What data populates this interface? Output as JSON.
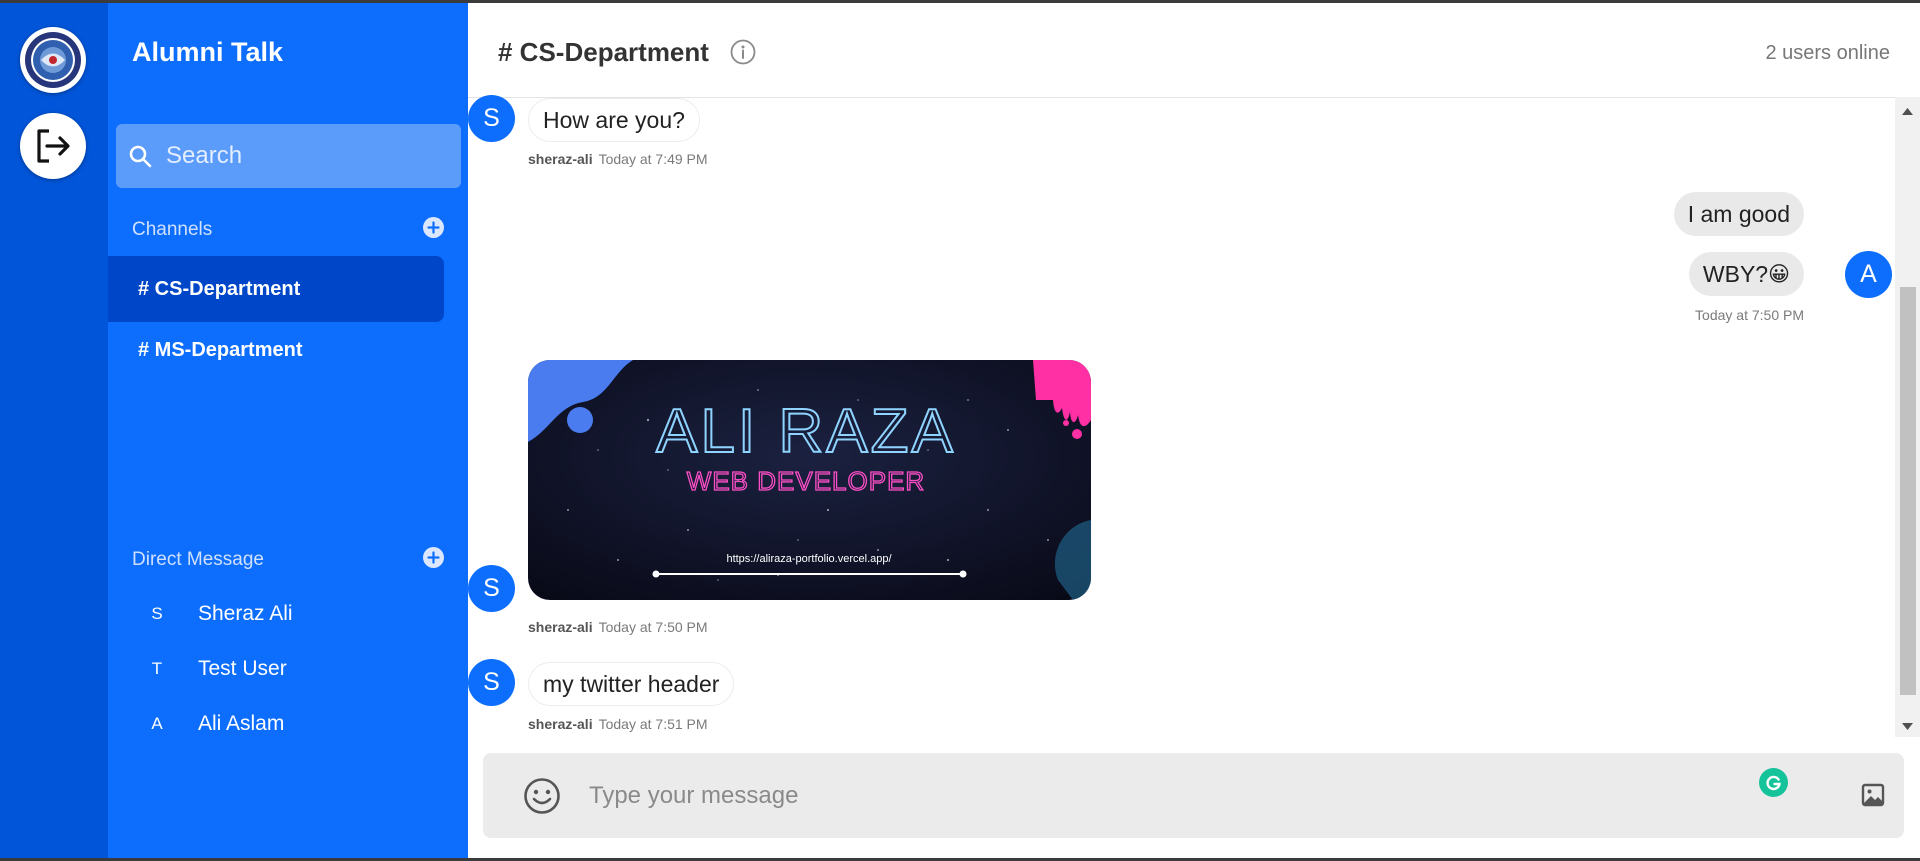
{
  "app": {
    "title": "Alumni Talk"
  },
  "rail": {
    "logo_icon": "university-seal-icon",
    "logout_icon": "logout-icon"
  },
  "search": {
    "placeholder": "Search",
    "icon": "search-icon"
  },
  "channels": {
    "label": "Channels",
    "items": [
      {
        "label": "# CS-Department",
        "active": true
      },
      {
        "label": "# MS-Department",
        "active": false
      }
    ]
  },
  "direct_messages": {
    "label": "Direct Message",
    "items": [
      {
        "initial": "S",
        "name": "Sheraz Ali"
      },
      {
        "initial": "T",
        "name": "Test User"
      },
      {
        "initial": "A",
        "name": "Ali Aslam"
      }
    ]
  },
  "chat": {
    "channel_title": "# CS-Department",
    "online_status": "2 users online",
    "messages": [
      {
        "avatar": "S",
        "text": "How are you?",
        "author": "sheraz-ali",
        "time": "Today at 7:49 PM",
        "side": "left"
      },
      {
        "text": "I am good",
        "side": "right"
      },
      {
        "avatar": "A",
        "text": "WBY?",
        "emoji": "😀",
        "time": "Today at 7:50 PM",
        "side": "right"
      },
      {
        "avatar": "S",
        "type": "image",
        "author": "sheraz-ali",
        "time": "Today at 7:50 PM",
        "side": "left",
        "image": {
          "headline": "ALI RAZA",
          "subline": "WEB DEVELOPER",
          "url": "https://aliraza-portfolio.vercel.app/"
        }
      },
      {
        "avatar": "S",
        "text": "my twitter header",
        "author": "sheraz-ali",
        "time": "Today at 7:51 PM",
        "side": "left"
      }
    ]
  },
  "composer": {
    "placeholder": "Type your message",
    "emoji_icon": "smiley-icon",
    "attach_icon": "image-icon"
  },
  "colors": {
    "rail": "#0055d9",
    "sidebar": "#0d6efd",
    "active_channel": "#0046c8",
    "avatar": "#0d6efd",
    "composer_bg": "#ebebeb",
    "grammarly": "#15c39a"
  }
}
